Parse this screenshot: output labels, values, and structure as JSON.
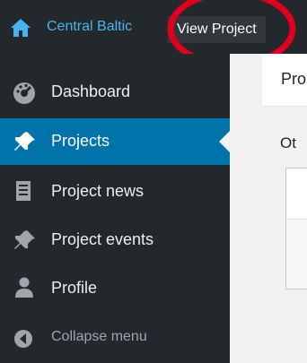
{
  "topbar": {
    "site_name": "Central Baltic",
    "view_project": "View Project"
  },
  "sidebar": {
    "items": [
      {
        "label": "Dashboard",
        "icon": "dashboard-icon"
      },
      {
        "label": "Projects",
        "icon": "pin-icon",
        "current": true
      },
      {
        "label": "Project news",
        "icon": "document-icon"
      },
      {
        "label": "Project events",
        "icon": "pin-icon"
      },
      {
        "label": "Profile",
        "icon": "user-icon"
      },
      {
        "label": "Collapse menu",
        "icon": "collapse-icon"
      }
    ]
  },
  "content": {
    "title_partial": "Pro",
    "section_partial": "Ot"
  },
  "colors": {
    "admin_bar": "#23282d",
    "sidebar_bg": "#23282d",
    "accent": "#0073aa",
    "site_link": "#44b5f0",
    "annotation": "#e0001b"
  }
}
